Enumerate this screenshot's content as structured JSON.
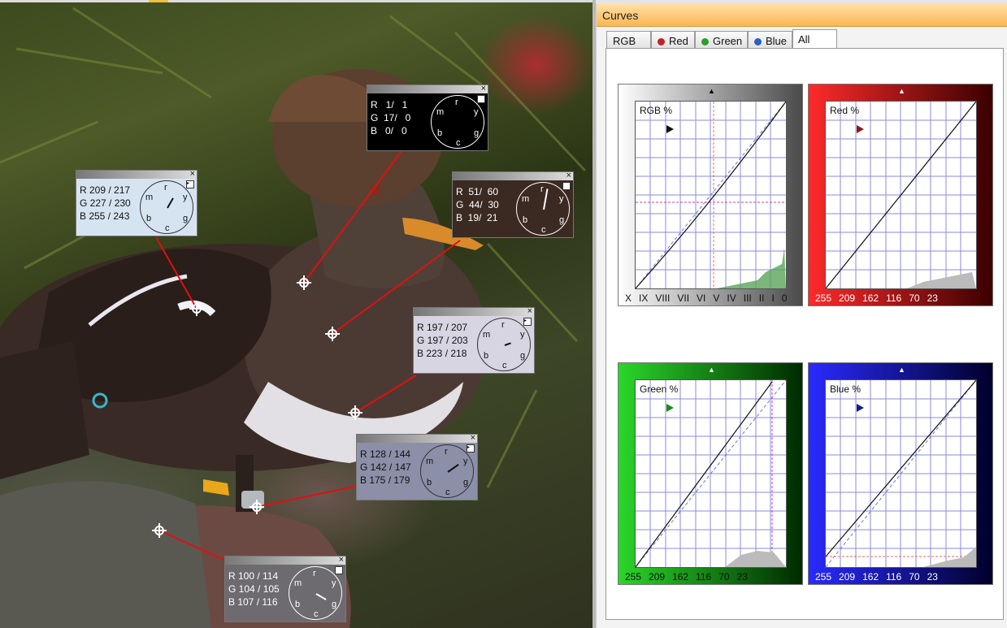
{
  "window": {
    "title": "Curves"
  },
  "tabs": [
    {
      "label": "RGB",
      "dot": ""
    },
    {
      "label": "Red",
      "dot": "#c0232a"
    },
    {
      "label": "Green",
      "dot": "#2aa02a"
    },
    {
      "label": "Blue",
      "dot": "#2a5fc0"
    },
    {
      "label": "All",
      "dot": "",
      "active": true
    }
  ],
  "graphs": {
    "rgb": {
      "label": "RGB %",
      "scale": [
        "X",
        "IX",
        "VIII",
        "VII",
        "VI",
        "V",
        "IV",
        "III",
        "II",
        "I",
        "0"
      ],
      "bg": "gray"
    },
    "red": {
      "label": "Red %",
      "scale": [
        "255",
        "209",
        "162",
        "116",
        "70",
        "23"
      ],
      "bg": "red"
    },
    "green": {
      "label": "Green %",
      "scale": [
        "255",
        "209",
        "162",
        "116",
        "70",
        "23"
      ],
      "bg": "green"
    },
    "blue": {
      "label": "Blue %",
      "scale": [
        "255",
        "209",
        "162",
        "116",
        "70",
        "23"
      ],
      "bg": "blue"
    }
  },
  "popups": [
    {
      "r": "R   1/   1",
      "g": "G  17/   0",
      "b": "B   0/   0",
      "theme": "black"
    },
    {
      "r": "R 209 / 217",
      "g": "G 227 / 230",
      "b": "B 255 / 243",
      "theme": "lightblue"
    },
    {
      "r": "R  51/  60",
      "g": "G  44/  30",
      "b": "B  19/  21",
      "theme": "brown"
    },
    {
      "r": "R 197 / 207",
      "g": "G 197 / 203",
      "b": "B 223 / 218",
      "theme": "lavender"
    },
    {
      "r": "R 128 / 144",
      "g": "G 142 / 147",
      "b": "B 175 / 179",
      "theme": "slate"
    },
    {
      "r": "R 100 / 114",
      "g": "G 104 / 105",
      "b": "B 107 / 116",
      "theme": "gray"
    }
  ],
  "dial_letters": {
    "r": "r",
    "y": "y",
    "g": "g",
    "c": "c",
    "b": "b",
    "m": "m"
  },
  "icons": {
    "close": "×",
    "menu": "▸"
  }
}
